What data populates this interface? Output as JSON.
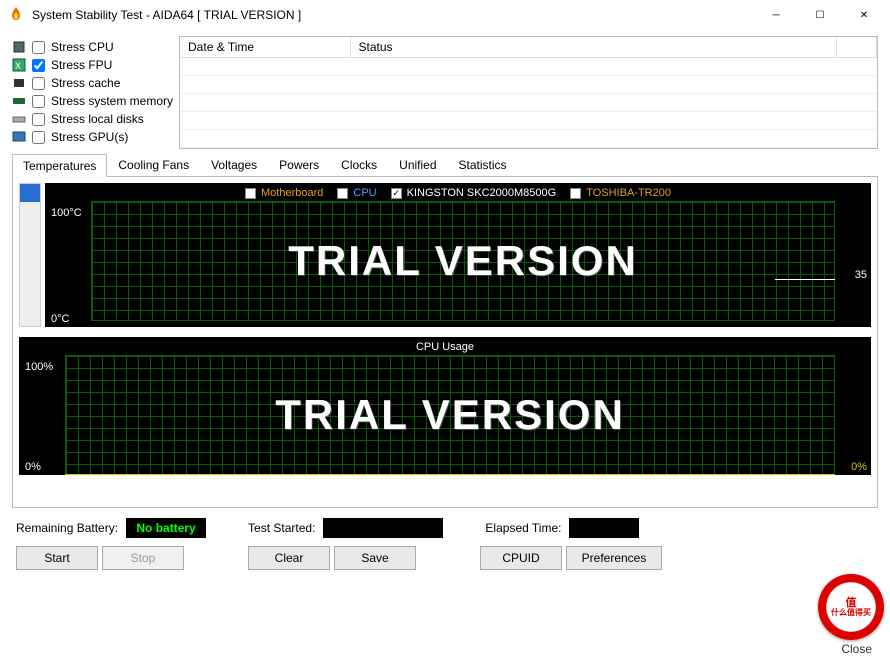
{
  "window": {
    "title": "System Stability Test - AIDA64   [ TRIAL VERSION ]"
  },
  "stress_options": [
    {
      "label": "Stress CPU",
      "checked": false
    },
    {
      "label": "Stress FPU",
      "checked": true
    },
    {
      "label": "Stress cache",
      "checked": false
    },
    {
      "label": "Stress system memory",
      "checked": false
    },
    {
      "label": "Stress local disks",
      "checked": false
    },
    {
      "label": "Stress GPU(s)",
      "checked": false
    }
  ],
  "log": {
    "col1": "Date & Time",
    "col2": "Status"
  },
  "tabs": [
    "Temperatures",
    "Cooling Fans",
    "Voltages",
    "Powers",
    "Clocks",
    "Unified",
    "Statistics"
  ],
  "active_tab": 0,
  "chart1": {
    "legend": [
      {
        "label": "Motherboard",
        "checked": false,
        "color": "#e0a020"
      },
      {
        "label": "CPU",
        "checked": false,
        "color": "#4aa0ff"
      },
      {
        "label": "KINGSTON SKC2000M8500G",
        "checked": true,
        "color": "#ffffff"
      },
      {
        "label": "TOSHIBA-TR200",
        "checked": false,
        "color": "#e0a020"
      }
    ],
    "y_top": "100°C",
    "y_bot": "0°C",
    "value_right": "35",
    "watermark": "TRIAL VERSION"
  },
  "chart2": {
    "title": "CPU Usage",
    "y_top": "100%",
    "y_bot": "0%",
    "value_right": "0%",
    "watermark": "TRIAL VERSION"
  },
  "status": {
    "battery_label": "Remaining Battery:",
    "battery_value": "No battery",
    "started_label": "Test Started:",
    "elapsed_label": "Elapsed Time:"
  },
  "buttons": {
    "start": "Start",
    "stop": "Stop",
    "clear": "Clear",
    "save": "Save",
    "cpuid": "CPUID",
    "prefs": "Preferences",
    "close": "Close"
  },
  "badge": {
    "l1": "值",
    "l2": "什么值得买"
  },
  "chart_data": [
    {
      "type": "line",
      "title": "Temperatures",
      "ylabel": "°C",
      "ylim": [
        0,
        100
      ],
      "series": [
        {
          "name": "KINGSTON SKC2000M8500G",
          "values": [
            35
          ]
        }
      ]
    },
    {
      "type": "line",
      "title": "CPU Usage",
      "ylabel": "%",
      "ylim": [
        0,
        100
      ],
      "series": [
        {
          "name": "CPU",
          "values": [
            0
          ]
        }
      ]
    }
  ]
}
